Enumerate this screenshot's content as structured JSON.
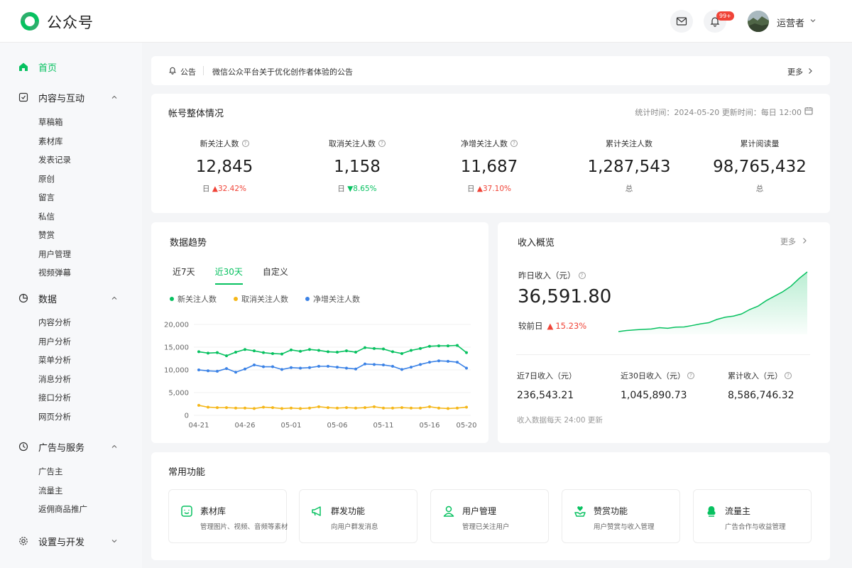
{
  "header": {
    "brand": "公众号",
    "badge": "99+",
    "user_name": "运营者",
    "icons": [
      "logo-icon",
      "mail-icon",
      "bell-icon",
      "chevron-down-icon"
    ]
  },
  "sidebar": {
    "home": "首页",
    "sections": [
      {
        "label": "内容与互动",
        "items": [
          "草稿箱",
          "素材库",
          "发表记录",
          "原创",
          "留言",
          "私信",
          "赞赏",
          "用户管理",
          "视频弹幕"
        ]
      },
      {
        "label": "数据",
        "items": [
          "内容分析",
          "用户分析",
          "菜单分析",
          "消息分析",
          "接口分析",
          "网页分析"
        ]
      },
      {
        "label": "广告与服务",
        "items": [
          "广告主",
          "流量主",
          "返佣商品推广"
        ]
      },
      {
        "label": "设置与开发",
        "items": []
      }
    ]
  },
  "announcement": {
    "tag": "公告",
    "text": "微信公众平台关于优化创作者体验的公告",
    "more": "更多"
  },
  "overview": {
    "title": "帐号整体情况",
    "meta": "统计时间：2024-05-20   更新时间：每日 12:00",
    "stats": [
      {
        "label": "新关注人数",
        "value": "12,845",
        "prefix": "日",
        "change": "32.42%",
        "dir": "up"
      },
      {
        "label": "取消关注人数",
        "value": "1,158",
        "prefix": "日",
        "change": "8.65%",
        "dir": "down"
      },
      {
        "label": "净增关注人数",
        "value": "11,687",
        "prefix": "日",
        "change": "37.10%",
        "dir": "up"
      },
      {
        "label": "累计关注人数",
        "value": "1,287,543",
        "prefix": "总",
        "change": "",
        "dir": ""
      },
      {
        "label": "累计阅读量",
        "value": "98,765,432",
        "prefix": "总",
        "change": "",
        "dir": ""
      }
    ]
  },
  "trend": {
    "title": "数据趋势",
    "tabs": [
      "近7天",
      "近30天",
      "自定义"
    ],
    "active_tab": 1
  },
  "income": {
    "title": "收入概览",
    "more": "更多",
    "yesterday_label": "昨日收入（元）",
    "yesterday_value": "36,591.80",
    "compare_label": "较前日",
    "compare_value": "15.23%",
    "subs": [
      {
        "label": "近7日收入（元）",
        "value": "236,543.21"
      },
      {
        "label": "近30日收入（元）",
        "value": "1,045,890.73"
      },
      {
        "label": "累计收入（元）",
        "value": "8,586,746.32"
      }
    ],
    "note": "收入数据每天 24:00 更新",
    "spark": [
      2,
      3,
      3.5,
      4,
      4.3,
      5.5,
      5,
      6,
      6.2,
      7.5,
      9,
      10,
      13,
      15,
      16,
      18,
      22,
      25,
      30,
      34,
      38,
      43,
      50,
      56
    ]
  },
  "common": {
    "title": "常用功能",
    "items": [
      {
        "title": "素材库",
        "desc": "管理图片、视频、音频等素材",
        "icon": "material-icon"
      },
      {
        "title": "群发功能",
        "desc": "向用户群发消息",
        "icon": "megaphone-icon"
      },
      {
        "title": "用户管理",
        "desc": "管理已关注用户",
        "icon": "user-icon"
      },
      {
        "title": "赞赏功能",
        "desc": "用户赞赏与收入管理",
        "icon": "reward-icon"
      },
      {
        "title": "流量主",
        "desc": "广告合作与收益管理",
        "icon": "traffic-icon"
      }
    ]
  },
  "colors": {
    "accent": "#07c160",
    "orange": "#f5b719",
    "blue": "#3b82e6",
    "red": "#f04438"
  },
  "chart_data": {
    "type": "line",
    "x": [
      "04-21",
      "04-22",
      "04-23",
      "04-24",
      "04-25",
      "04-26",
      "04-27",
      "04-28",
      "04-29",
      "04-30",
      "05-01",
      "05-02",
      "05-03",
      "05-04",
      "05-05",
      "05-06",
      "05-07",
      "05-08",
      "05-09",
      "05-10",
      "05-11",
      "05-12",
      "05-13",
      "05-14",
      "05-15",
      "05-16",
      "05-17",
      "05-18",
      "05-19",
      "05-20"
    ],
    "xticks": [
      "04-21",
      "04-26",
      "05-01",
      "05-06",
      "05-11",
      "05-16",
      "05-20"
    ],
    "yticks": [
      "0",
      "5,000",
      "10,000",
      "15,000",
      "20,000"
    ],
    "ylim": [
      0,
      20000
    ],
    "series": [
      {
        "name": "新关注人数",
        "color": "#07c160",
        "values": [
          14000,
          13700,
          13800,
          13100,
          13900,
          14500,
          14200,
          13800,
          13600,
          13500,
          14400,
          14100,
          14500,
          14300,
          14000,
          13900,
          14200,
          13900,
          14900,
          14700,
          14600,
          14000,
          13600,
          14300,
          14700,
          15200,
          15300,
          15300,
          15400,
          13800
        ]
      },
      {
        "name": "取消关注人数",
        "color": "#f5b719",
        "values": [
          2200,
          1800,
          1700,
          1700,
          1600,
          1600,
          1500,
          1800,
          1700,
          1500,
          1600,
          1500,
          1600,
          1900,
          1700,
          1600,
          1700,
          1600,
          1700,
          1900,
          1600,
          1600,
          1700,
          1600,
          1600,
          1900,
          1600,
          1500,
          1600,
          1800
        ]
      },
      {
        "name": "净增关注人数",
        "color": "#3b82e6",
        "values": [
          10000,
          9800,
          9700,
          10300,
          9500,
          10200,
          11100,
          10700,
          10700,
          10100,
          10500,
          10400,
          10500,
          10800,
          10800,
          10600,
          10400,
          10200,
          11300,
          11200,
          11100,
          10800,
          10100,
          10600,
          11200,
          11700,
          12000,
          11900,
          11700,
          10400
        ]
      }
    ]
  }
}
